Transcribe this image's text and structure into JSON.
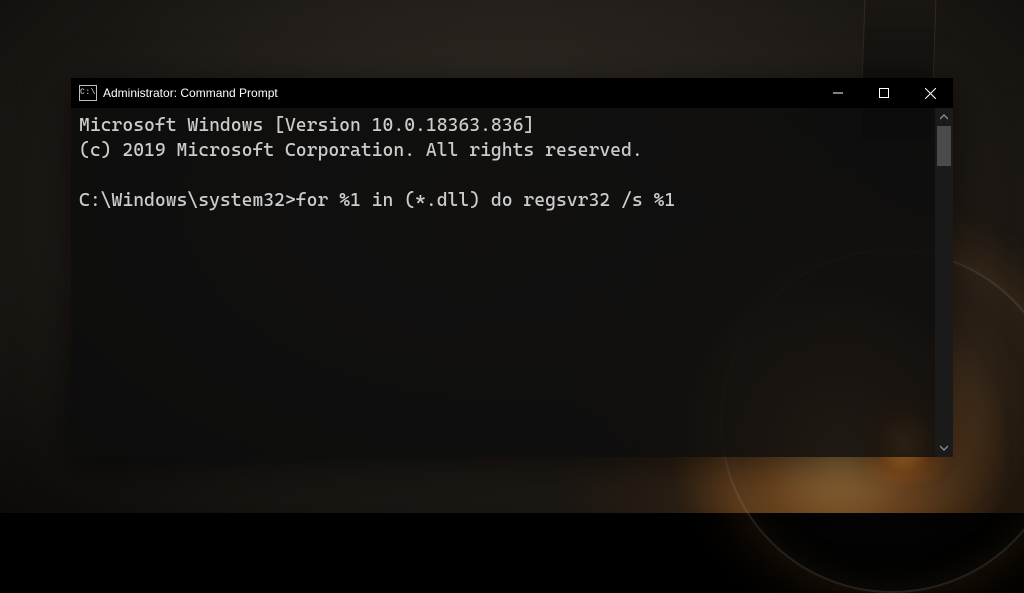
{
  "window": {
    "title": "Administrator: Command Prompt",
    "icon_glyph": "C:\\"
  },
  "console": {
    "banner_line1": "Microsoft Windows [Version 10.0.18363.836]",
    "banner_line2": "(c) 2019 Microsoft Corporation. All rights reserved.",
    "blank": "",
    "prompt": "C:\\Windows\\system32>",
    "command": "for %1 in (*.dll) do regsvr32 /s %1"
  }
}
